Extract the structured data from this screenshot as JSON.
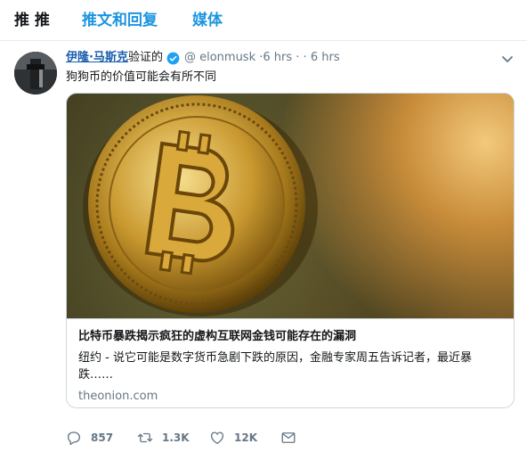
{
  "tabs": [
    {
      "label": "推 推"
    },
    {
      "label": "推文和回复"
    },
    {
      "label": "媒体"
    }
  ],
  "tweet": {
    "author_name": "伊隆·马斯克",
    "verified_label": "验证的",
    "handle": "@ elonmusk",
    "time_1": "·6 hrs",
    "separator": "· ·",
    "time_2": "6 hrs",
    "text": "狗狗币的价值可能会有所不同",
    "card": {
      "title": "比特币暴跌揭示疯狂的虚构互联网金钱可能存在的漏洞",
      "description": "纽约 - 说它可能是数字货币急剧下跌的原因，金融专家周五告诉记者，最近暴跌……",
      "domain": "theonion.com"
    },
    "actions": {
      "reply_count": "857",
      "retweet_count": "1.3K",
      "like_count": "12K"
    }
  },
  "colors": {
    "accent": "#1b95e0",
    "name_link": "#1b5fae",
    "secondary_text": "#657786",
    "border": "#ccd6dd"
  },
  "icons": [
    "verified-badge-icon",
    "chevron-down-icon",
    "reply-icon",
    "retweet-icon",
    "like-icon",
    "direct-message-icon"
  ]
}
